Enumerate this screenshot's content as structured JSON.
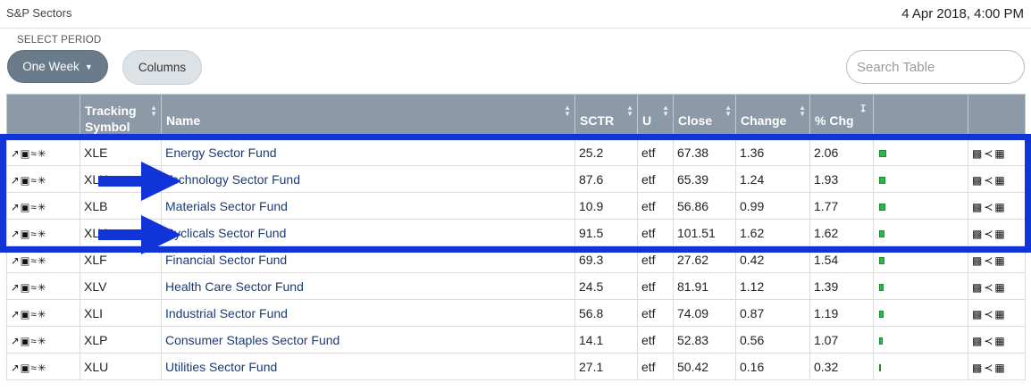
{
  "header": {
    "title": "S&P Sectors",
    "timestamp": "4 Apr 2018, 4:00 PM"
  },
  "controls": {
    "period_label": "SELECT PERIOD",
    "period_value": "One Week",
    "columns_label": "Columns",
    "search_placeholder": "Search Table"
  },
  "table": {
    "columns": [
      "Tracking Symbol",
      "Name",
      "SCTR",
      "U",
      "Close",
      "Change",
      "% Chg"
    ],
    "rows": [
      {
        "symbol": "XLE",
        "name": "Energy Sector Fund",
        "sctr": "25.2",
        "u": "etf",
        "close": "67.38",
        "change": "1.36",
        "pct": "2.06"
      },
      {
        "symbol": "XLK",
        "name": "Technology Sector Fund",
        "sctr": "87.6",
        "u": "etf",
        "close": "65.39",
        "change": "1.24",
        "pct": "1.93"
      },
      {
        "symbol": "XLB",
        "name": "Materials Sector Fund",
        "sctr": "10.9",
        "u": "etf",
        "close": "56.86",
        "change": "0.99",
        "pct": "1.77"
      },
      {
        "symbol": "XLY",
        "name": "Cyclicals Sector Fund",
        "sctr": "91.5",
        "u": "etf",
        "close": "101.51",
        "change": "1.62",
        "pct": "1.62"
      },
      {
        "symbol": "XLF",
        "name": "Financial Sector Fund",
        "sctr": "69.3",
        "u": "etf",
        "close": "27.62",
        "change": "0.42",
        "pct": "1.54"
      },
      {
        "symbol": "XLV",
        "name": "Health Care Sector Fund",
        "sctr": "24.5",
        "u": "etf",
        "close": "81.91",
        "change": "1.12",
        "pct": "1.39"
      },
      {
        "symbol": "XLI",
        "name": "Industrial Sector Fund",
        "sctr": "56.8",
        "u": "etf",
        "close": "74.09",
        "change": "0.87",
        "pct": "1.19"
      },
      {
        "symbol": "XLP",
        "name": "Consumer Staples Sector Fund",
        "sctr": "14.1",
        "u": "etf",
        "close": "52.83",
        "change": "0.56",
        "pct": "1.07"
      },
      {
        "symbol": "XLU",
        "name": "Utilities Sector Fund",
        "sctr": "27.1",
        "u": "etf",
        "close": "50.42",
        "change": "0.16",
        "pct": "0.32"
      }
    ]
  },
  "row_icons": [
    "line-chart-icon",
    "area-chart-icon",
    "perf-chart-icon",
    "seasonality-icon"
  ],
  "action_icons": [
    "candlestick-icon",
    "share-icon",
    "grid-icon"
  ],
  "colors": {
    "header_bg": "#8b9aa6",
    "link": "#1a3b78",
    "bar": "#2fb64a",
    "highlight": "#1134d9",
    "button": "#6a7c8c"
  }
}
